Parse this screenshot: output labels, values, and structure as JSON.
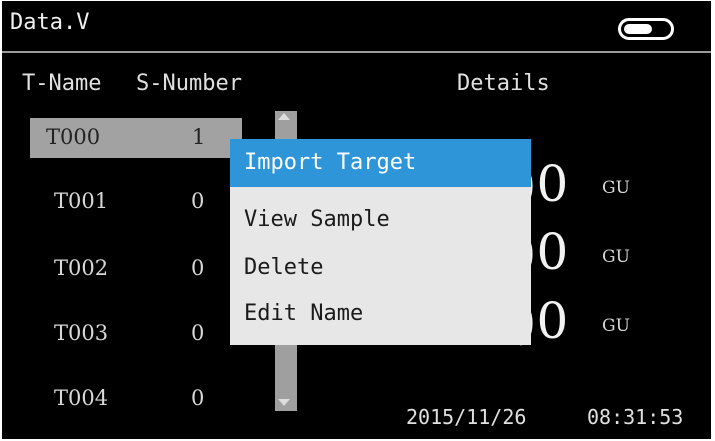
{
  "title": "Data.V",
  "columns": {
    "name_header": "T-Name",
    "number_header": "S-Number",
    "details_header": "Details"
  },
  "rows": [
    {
      "name": "T000",
      "number": "1",
      "selected": true
    },
    {
      "name": "T001",
      "number": "0",
      "selected": false
    },
    {
      "name": "T002",
      "number": "0",
      "selected": false
    },
    {
      "name": "T003",
      "number": "0",
      "selected": false
    },
    {
      "name": "T004",
      "number": "0",
      "selected": false
    }
  ],
  "details": [
    {
      "value": ")0",
      "unit": "GU"
    },
    {
      "value": ")0",
      "unit": "GU"
    },
    {
      "value": ")0",
      "unit": "GU"
    }
  ],
  "status": {
    "date": "2015/11/26",
    "time": "08:31:53"
  },
  "context_menu": {
    "items": [
      {
        "label": "Import Target",
        "active": true
      },
      {
        "label": "View Sample",
        "active": false
      },
      {
        "label": "Delete",
        "active": false
      },
      {
        "label": "Edit Name",
        "active": false
      }
    ]
  },
  "colors": {
    "menu_highlight": "#2d95d8",
    "menu_background": "#e7e7e7",
    "selected_row": "#a2a2a2",
    "screen_background": "#000000"
  },
  "icons": {
    "battery": "battery-icon",
    "scroll_up": "arrow-up-icon",
    "scroll_down": "arrow-down-icon"
  }
}
